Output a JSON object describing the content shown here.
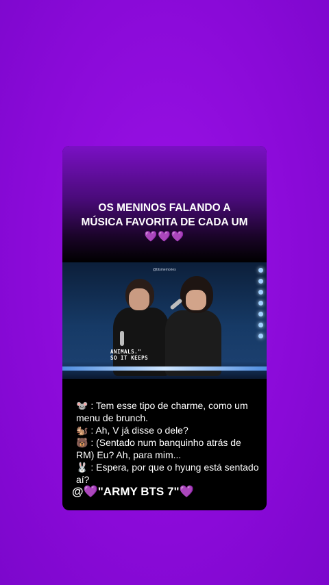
{
  "post": {
    "headline_line1": "OS MENINOS FALANDO A",
    "headline_line2": "MÚSICA FAVORITA DE CADA UM",
    "headline_hearts": "💜💜💜",
    "footer": "@💜\"ARMY BTS 7\"💜"
  },
  "video": {
    "watermark": "@btsmemories",
    "lyric_line1": "ANIMALS.\"",
    "lyric_line2": "SO IT KEEPS"
  },
  "dialogue": [
    {
      "emoji": "🐭",
      "text": ": Tem esse tipo de charme, como um menu de brunch."
    },
    {
      "emoji": "🐿️",
      "text": ": Ah, V já disse o dele?"
    },
    {
      "emoji": "🐻",
      "text": ": (Sentado num banquinho atrás de RM) Eu? Ah, para mim..."
    },
    {
      "emoji": "🐰",
      "text": ": Espera, por que o hyung está sentado aí?"
    }
  ],
  "colors": {
    "background": "#8a0ad8",
    "card": "#000000",
    "text": "#ffffff"
  }
}
